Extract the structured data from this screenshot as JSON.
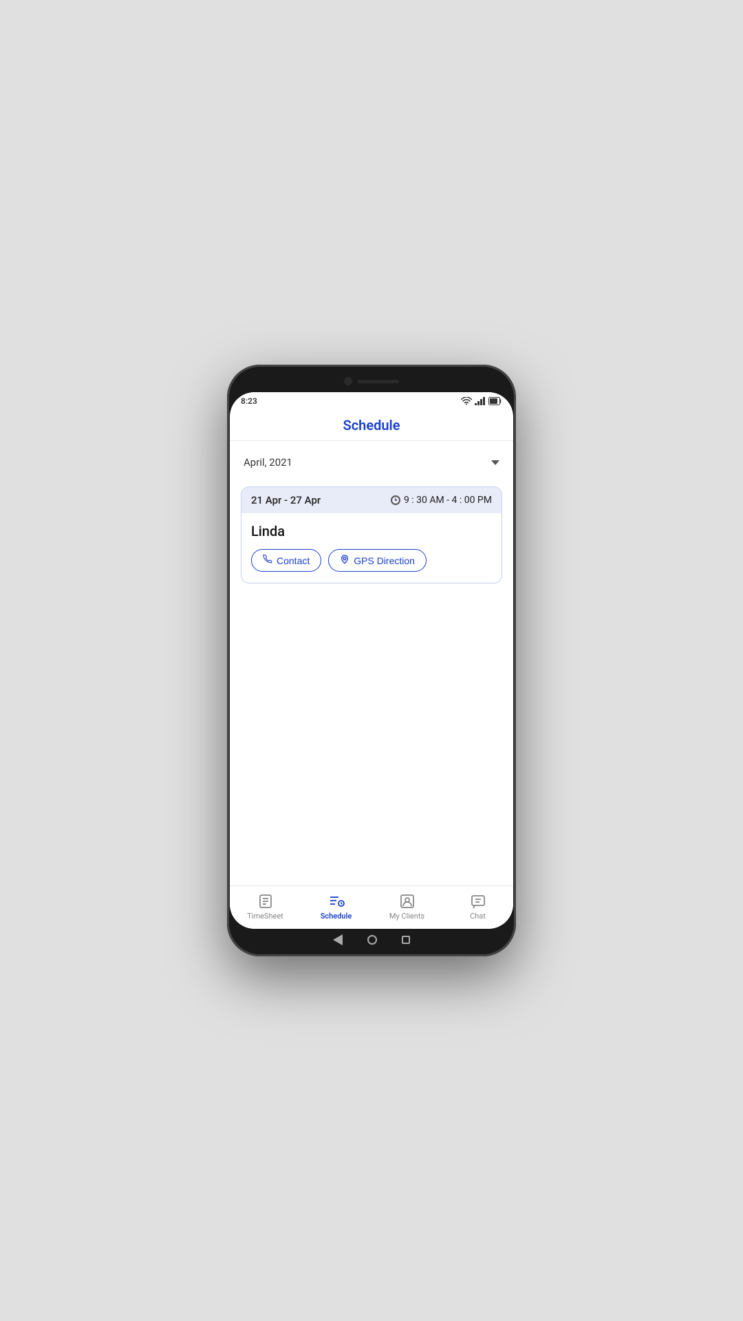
{
  "status_bar": {
    "time": "8:23",
    "wifi": true,
    "signal": true,
    "battery": true
  },
  "header": {
    "title": "Schedule"
  },
  "month_selector": {
    "label": "April, 2021",
    "chevron": "▼"
  },
  "schedule_card": {
    "date_range": "21 Apr - 27 Apr",
    "time": "9 : 30 AM - 4 : 00 PM",
    "client_name": "Linda",
    "contact_btn": "Contact",
    "gps_btn": "GPS Direction"
  },
  "bottom_nav": {
    "items": [
      {
        "id": "timesheet",
        "label": "TimeSheet",
        "active": false
      },
      {
        "id": "schedule",
        "label": "Schedule",
        "active": true
      },
      {
        "id": "my-clients",
        "label": "My Clients",
        "active": false
      },
      {
        "id": "chat",
        "label": "Chat",
        "active": false
      }
    ]
  }
}
